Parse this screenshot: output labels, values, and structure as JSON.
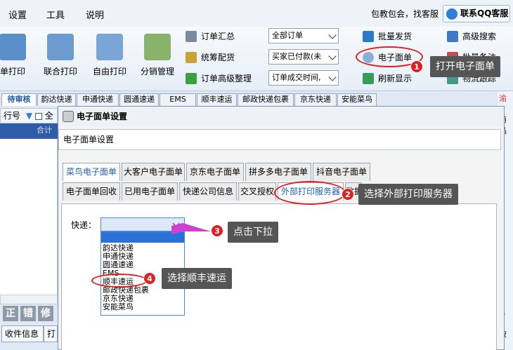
{
  "menubar": {
    "items": [
      "设置",
      "工具",
      "说明"
    ],
    "tagline": "包教包会，找客服",
    "qq_button": "联系QQ客服"
  },
  "toolbar": {
    "big": [
      "单打印",
      "联合打印",
      "自由打印",
      "分销管理"
    ],
    "col1": [
      "订单汇总",
      "统筹配货",
      "订单高级整理"
    ],
    "combos": [
      "全部订单",
      "买家已付款(未",
      "订单成交时间,"
    ],
    "col2": [
      "批量发货",
      "电子面单",
      "刷新显示"
    ],
    "col3": [
      "高级搜索",
      "批量备注",
      "物流跟踪"
    ]
  },
  "tabs": [
    "待审核",
    "韵达快递",
    "申通快递",
    "圆通速递",
    "EMS",
    "顺丰速运",
    "邮政快递包裹",
    "京东快递",
    "安能菜鸟"
  ],
  "grid": {
    "header": "行号",
    "header_suffix": "全",
    "sum": "合计",
    "edit_buttons": [
      "正",
      "错",
      "修"
    ],
    "bottom_tabs": [
      "收件信息",
      "打"
    ]
  },
  "right_strip": {
    "header": "商品",
    "letter": "渝",
    "bottom": "0",
    "bottom2": "破"
  },
  "dialog": {
    "title": "电子面单设置",
    "group_label": "电子面单设置",
    "tabs_row1": [
      "菜鸟电子面单",
      "大客户电子面单",
      "京东电子面单",
      "拼多多电子面单",
      "抖音电子面单"
    ],
    "tabs_row2": [
      "电子面单回收",
      "已用电子面单",
      "快递公司信息",
      "交叉授权",
      "外部打印服务器",
      "数据"
    ],
    "express_label": "快递：",
    "dropdown_options": [
      "韵达快递",
      "申通快递",
      "圆通速递",
      "EMS",
      "顺丰速运",
      "邮政快递包裹",
      "京东快递",
      "安能菜鸟"
    ]
  },
  "callouts": {
    "c1": "打开电子面单",
    "c2": "选择外部打印服务器",
    "c3": "点击下拉",
    "c4": "选择顺丰速运",
    "n1": "1",
    "n2": "2",
    "n3": "3",
    "n4": "4"
  }
}
